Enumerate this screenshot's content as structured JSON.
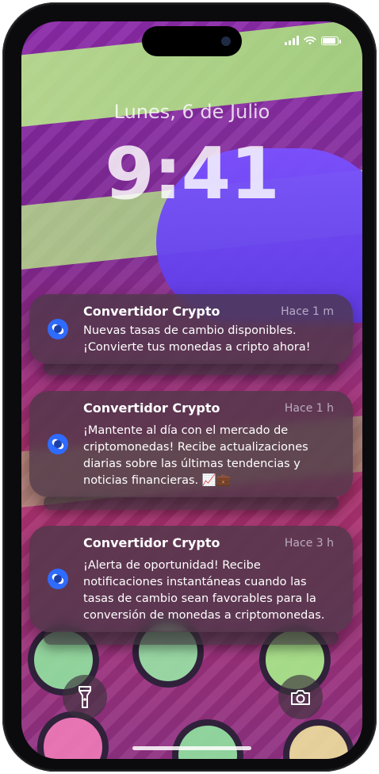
{
  "lock_screen": {
    "date": "Lunes, 6 de Julio",
    "time": "9:41"
  },
  "notifications": [
    {
      "app": "Convertidor Crypto",
      "time": "Hace 1 m",
      "message": "Nuevas tasas de cambio disponibles. ¡Convierte tus monedas a cripto ahora!"
    },
    {
      "app": "Convertidor Crypto",
      "time": "Hace 1 h",
      "message": "¡Mantente al día con el mercado de criptomonedas! Recibe actualizaciones diarias sobre las últimas tendencias y noticias financieras. 📈💼"
    },
    {
      "app": "Convertidor Crypto",
      "time": "Hace 3 h",
      "message": "¡Alerta de oportunidad! Recibe notificaciones instantáneas cuando las tasas de cambio sean favorables para la conversión de monedas a criptomonedas."
    }
  ],
  "icons": {
    "app": "crypto-app-icon",
    "flashlight": "flashlight-icon",
    "camera": "camera-icon",
    "signal": "signal-icon",
    "wifi": "wifi-icon",
    "battery": "battery-icon"
  },
  "colors": {
    "app_icon_blue": "#2f6bff",
    "notification_bg": "#4b3746"
  }
}
